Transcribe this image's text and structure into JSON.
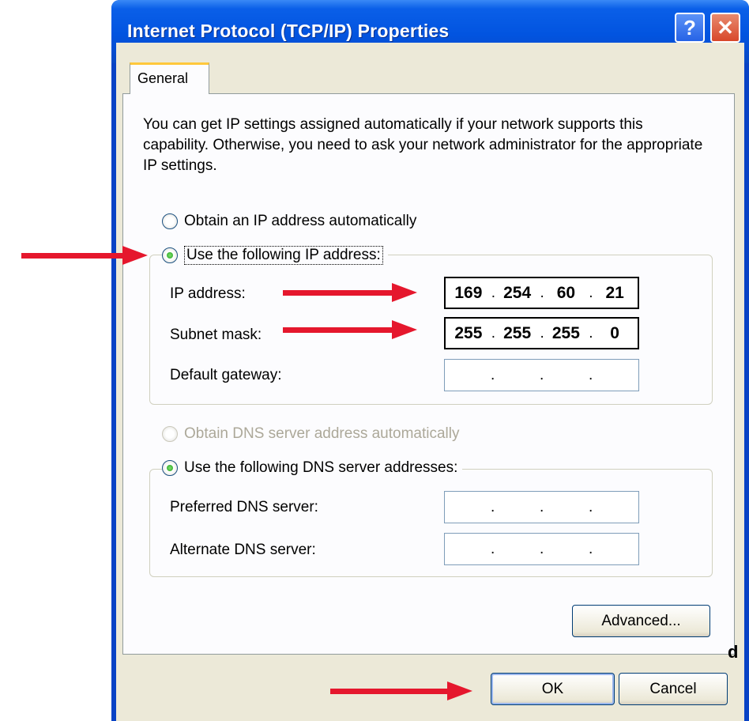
{
  "window": {
    "title": "Internet Protocol (TCP/IP) Properties",
    "help_label": "?",
    "close_label": "✕"
  },
  "tabs": [
    {
      "label": "General",
      "selected": true
    }
  ],
  "intro_text": "You can get IP settings assigned automatically if your network supports this capability. Otherwise, you need to ask your network administrator for the appropriate IP settings.",
  "ip_section": {
    "auto_label": "Obtain an IP address automatically",
    "auto_selected": false,
    "manual_label": "Use the following IP address:",
    "manual_selected": true,
    "fields": [
      {
        "label": "IP address:",
        "octets": [
          "169",
          "254",
          "60",
          "21"
        ]
      },
      {
        "label": "Subnet mask:",
        "octets": [
          "255",
          "255",
          "255",
          "0"
        ]
      },
      {
        "label": "Default gateway:",
        "octets": [
          "",
          "",
          "",
          ""
        ]
      }
    ]
  },
  "dns_section": {
    "auto_label": "Obtain DNS server address automatically",
    "auto_selected": false,
    "auto_disabled": true,
    "manual_label": "Use the following DNS server addresses:",
    "manual_selected": true,
    "fields": [
      {
        "label": "Preferred DNS server:",
        "octets": [
          "",
          "",
          "",
          ""
        ]
      },
      {
        "label": "Alternate DNS server:",
        "octets": [
          "",
          "",
          "",
          ""
        ]
      }
    ]
  },
  "buttons": {
    "advanced": "Advanced...",
    "ok": "OK",
    "cancel": "Cancel"
  },
  "stray_text": "d",
  "colors": {
    "titlebar": "#0254e0",
    "annotation_arrow": "#e5172d",
    "dialog_bg": "#ece9d8"
  }
}
